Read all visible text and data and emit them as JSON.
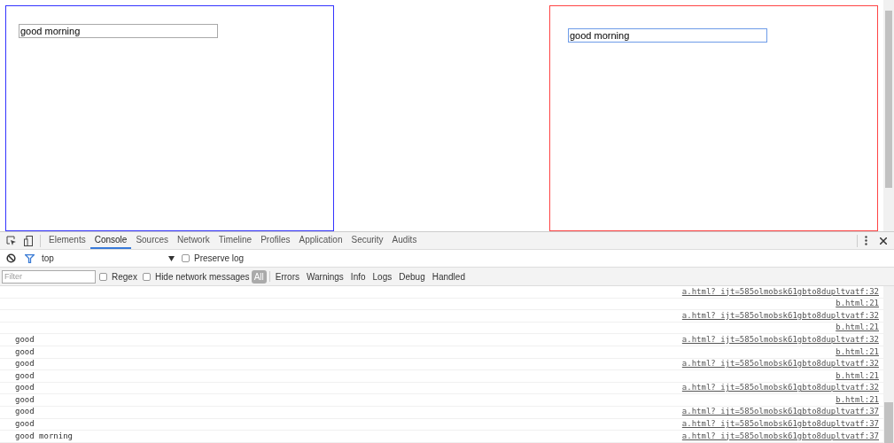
{
  "frames": [
    {
      "color": "#3333ff",
      "input": {
        "value": "good morning",
        "focused": false
      }
    },
    {
      "color": "#ff4444",
      "input": {
        "value": "good morning",
        "focused": true
      }
    }
  ],
  "devtools": {
    "tabs": [
      {
        "label": "Elements",
        "selected": false
      },
      {
        "label": "Console",
        "selected": true
      },
      {
        "label": "Sources",
        "selected": false
      },
      {
        "label": "Network",
        "selected": false
      },
      {
        "label": "Timeline",
        "selected": false
      },
      {
        "label": "Profiles",
        "selected": false
      },
      {
        "label": "Application",
        "selected": false
      },
      {
        "label": "Security",
        "selected": false
      },
      {
        "label": "Audits",
        "selected": false
      }
    ],
    "context": "top",
    "preserve_log": {
      "label": "Preserve log",
      "checked": false
    },
    "filter": {
      "placeholder": "Filter"
    },
    "options": [
      {
        "label": "Regex",
        "checked": false
      },
      {
        "label": "Hide network messages",
        "checked": false
      }
    ],
    "levels": [
      {
        "label": "All",
        "selected": true
      },
      {
        "label": "Errors",
        "selected": false
      },
      {
        "label": "Warnings",
        "selected": false
      },
      {
        "label": "Info",
        "selected": false
      },
      {
        "label": "Logs",
        "selected": false
      },
      {
        "label": "Debug",
        "selected": false
      },
      {
        "label": "Handled",
        "selected": false
      }
    ],
    "console_rows": [
      {
        "source": "a.html?_ijt=585olmobsk61gbto8dupltvatf:32"
      },
      {
        "source": "b.html:21"
      },
      {
        "source": "a.html?_ijt=585olmobsk61gbto8dupltvatf:32"
      },
      {
        "source": "b.html:21"
      },
      {
        "message": "good",
        "source": "a.html?_ijt=585olmobsk61gbto8dupltvatf:32"
      },
      {
        "message": "good",
        "source": "b.html:21"
      },
      {
        "message": "good",
        "source": "a.html?_ijt=585olmobsk61gbto8dupltvatf:32"
      },
      {
        "message": "good",
        "source": "b.html:21"
      },
      {
        "message": "good",
        "source": "a.html?_ijt=585olmobsk61gbto8dupltvatf:32"
      },
      {
        "message": "good",
        "source": "b.html:21"
      },
      {
        "message": "good",
        "source": "a.html?_ijt=585olmobsk61gbto8dupltvatf:37"
      },
      {
        "message": "good",
        "source": "a.html?_ijt=585olmobsk61gbto8dupltvatf:37"
      },
      {
        "message": "good morning",
        "source": "a.html?_ijt=585olmobsk61gbto8dupltvatf:37"
      }
    ]
  }
}
